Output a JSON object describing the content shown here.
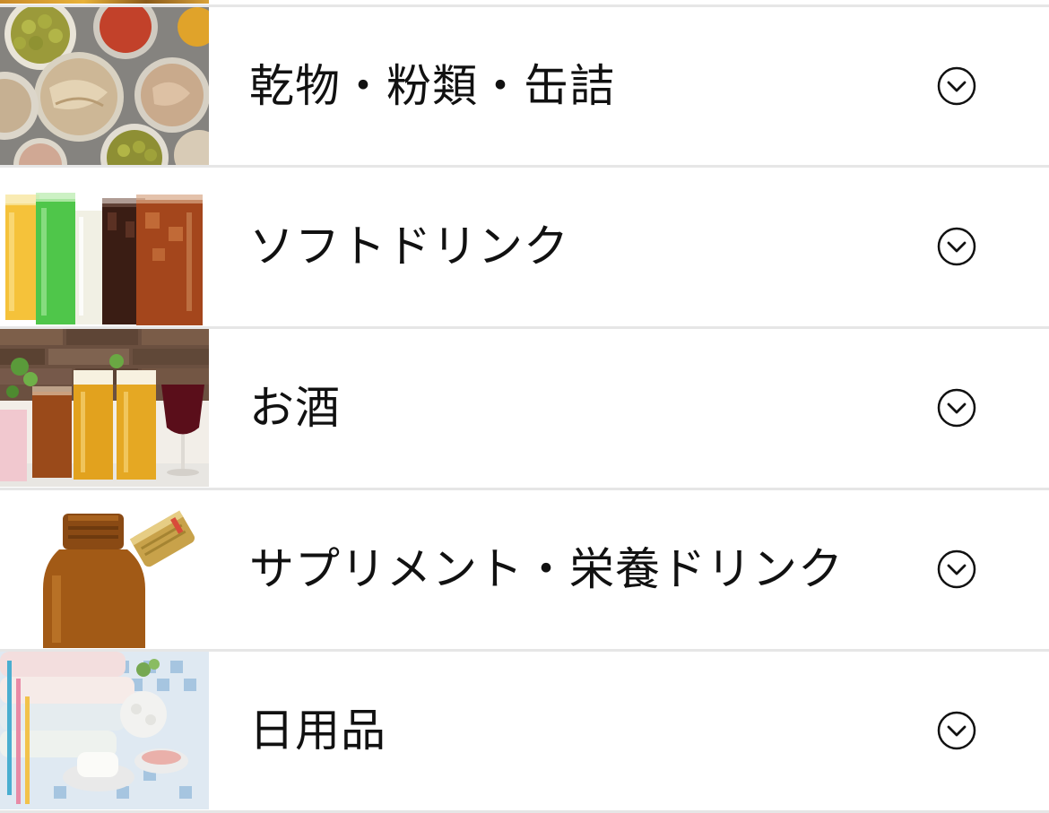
{
  "categories": [
    {
      "label": "乾物・粉類・缶詰",
      "thumb_icon": "canned-food-image",
      "expand_icon": "chevron-circle-down-icon"
    },
    {
      "label": "ソフトドリンク",
      "thumb_icon": "soft-drinks-image",
      "expand_icon": "chevron-circle-down-icon"
    },
    {
      "label": "お酒",
      "thumb_icon": "alcohol-drinks-image",
      "expand_icon": "chevron-circle-down-icon"
    },
    {
      "label": "サプリメント・栄養ドリンク",
      "thumb_icon": "supplement-bottle-image",
      "expand_icon": "chevron-circle-down-icon"
    },
    {
      "label": "日用品",
      "thumb_icon": "daily-goods-image",
      "expand_icon": "chevron-circle-down-icon"
    }
  ],
  "colors": {
    "text": "#111111",
    "divider": "#e6e6e6",
    "background": "#ffffff"
  }
}
